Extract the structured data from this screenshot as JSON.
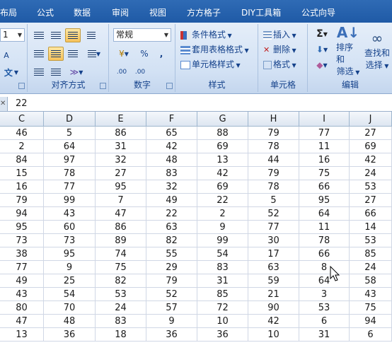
{
  "tabs": [
    "布局",
    "公式",
    "数据",
    "审阅",
    "视图",
    "方方格子",
    "DIY工具箱",
    "公式向导"
  ],
  "font_group": {
    "size_value": "1",
    "phonetic": "文",
    "grow_font": "A"
  },
  "alignment_group": {
    "label": "对齐方式"
  },
  "number_group": {
    "label": "数字",
    "format_value": "常规",
    "percent": "%",
    "comma": ",",
    "inc_decimal": ".00",
    "dec_decimal": ".00"
  },
  "styles_group": {
    "label": "样式",
    "items": [
      "条件格式",
      "套用表格格式",
      "单元格样式"
    ]
  },
  "cells_group": {
    "label": "单元格",
    "items": [
      "插入",
      "删除",
      "格式"
    ]
  },
  "editing_group": {
    "label": "编辑",
    "sigma": "Σ",
    "sort_label": "排序和",
    "sort_label2": "筛选",
    "find_label": "查找和",
    "find_label2": "选择"
  },
  "formula_bar": {
    "value": "22"
  },
  "columns": [
    "C",
    "D",
    "E",
    "F",
    "G",
    "H",
    "I",
    "J"
  ],
  "rows": [
    [
      46,
      5,
      86,
      65,
      88,
      79,
      77,
      27
    ],
    [
      2,
      64,
      31,
      42,
      69,
      78,
      11,
      69
    ],
    [
      84,
      97,
      32,
      48,
      13,
      44,
      16,
      42
    ],
    [
      15,
      78,
      27,
      83,
      42,
      79,
      75,
      24
    ],
    [
      16,
      77,
      95,
      32,
      69,
      78,
      66,
      53
    ],
    [
      79,
      99,
      7,
      49,
      22,
      5,
      95,
      27
    ],
    [
      94,
      43,
      47,
      22,
      2,
      52,
      64,
      66
    ],
    [
      95,
      60,
      86,
      63,
      9,
      77,
      11,
      14
    ],
    [
      73,
      73,
      89,
      82,
      99,
      30,
      78,
      53
    ],
    [
      38,
      95,
      74,
      55,
      54,
      17,
      66,
      85
    ],
    [
      77,
      9,
      75,
      29,
      83,
      63,
      8,
      24
    ],
    [
      49,
      25,
      82,
      79,
      31,
      59,
      64,
      58
    ],
    [
      43,
      54,
      53,
      52,
      85,
      21,
      3,
      43
    ],
    [
      80,
      70,
      24,
      57,
      72,
      90,
      53,
      75
    ],
    [
      47,
      48,
      83,
      9,
      10,
      42,
      6,
      94
    ],
    [
      13,
      36,
      18,
      36,
      36,
      10,
      31,
      6
    ]
  ],
  "colors": {
    "ribbon_tab_bar": "#1f5aa6",
    "group_label": "#15428b",
    "highlight": "#f7c25a"
  }
}
